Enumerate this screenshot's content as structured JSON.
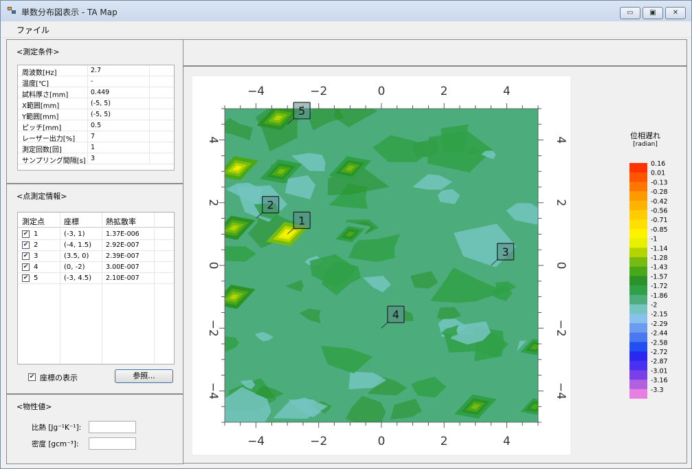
{
  "window": {
    "title": "単数分布図表示 - TA Map",
    "minimize_glyph": "▭",
    "maximize_glyph": "▣",
    "close_glyph": "✕"
  },
  "menu": {
    "file": "ファイル"
  },
  "measurement_conditions": {
    "title": "<測定条件>",
    "rows": [
      {
        "label": "周波数[Hz]",
        "value": "2.7"
      },
      {
        "label": "温度[℃]",
        "value": "-"
      },
      {
        "label": "試料厚さ[mm]",
        "value": "0.449"
      },
      {
        "label": "X範囲[mm]",
        "value": "(-5, 5)"
      },
      {
        "label": "Y範囲[mm]",
        "value": "(-5, 5)"
      },
      {
        "label": "ピッチ[mm]",
        "value": "0.5"
      },
      {
        "label": "レーザー出力[%]",
        "value": "7"
      },
      {
        "label": "測定回数[回]",
        "value": "1"
      },
      {
        "label": "サンプリング間隔[s]",
        "value": "3"
      }
    ]
  },
  "point_info": {
    "title": "<点測定情報>",
    "headers": {
      "point": "測定点",
      "coord": "座標",
      "diffusivity": "熱拡散率"
    },
    "rows": [
      {
        "checked": true,
        "point": "1",
        "coord": "(-3, 1)",
        "diffusivity": "1.37E-006"
      },
      {
        "checked": true,
        "point": "2",
        "coord": "(-4, 1.5)",
        "diffusivity": "2.92E-007"
      },
      {
        "checked": true,
        "point": "3",
        "coord": "(3.5, 0)",
        "diffusivity": "2.39E-007"
      },
      {
        "checked": true,
        "point": "4",
        "coord": "(0, -2)",
        "diffusivity": "3.00E-007"
      },
      {
        "checked": true,
        "point": "5",
        "coord": "(-3, 4.5)",
        "diffusivity": "2.10E-007"
      }
    ],
    "show_coords_label": "座標の表示",
    "show_coords_checked": true,
    "browse_button": "参照..."
  },
  "properties": {
    "title": "<物性値>",
    "specific_heat_label": "比熱 [Jg⁻¹K⁻¹]:",
    "specific_heat_value": "",
    "density_label": "密度 [gcm⁻³]:",
    "density_value": ""
  },
  "chart_data": {
    "type": "heatmap",
    "xlim": [
      -5,
      5
    ],
    "ylim": [
      -5,
      5
    ],
    "xticks": [
      -4,
      -2,
      0,
      2,
      4
    ],
    "yticks": [
      -4,
      -2,
      0,
      2,
      4
    ],
    "tick_labels": [
      "−4",
      "−2",
      "0",
      "2",
      "4"
    ],
    "colorbar": {
      "title": "位相遅れ",
      "unit": "[radian]",
      "levels": [
        "0.16",
        "0.01",
        "-0.13",
        "-0.28",
        "-0.42",
        "-0.56",
        "-0.71",
        "-0.85",
        "-1",
        "-1.14",
        "-1.28",
        "-1.43",
        "-1.57",
        "-1.72",
        "-1.86",
        "-2",
        "-2.15",
        "-2.29",
        "-2.44",
        "-2.58",
        "-2.72",
        "-2.87",
        "-3.01",
        "-3.16",
        "-3.3"
      ],
      "colors": [
        "#ff3300",
        "#ff5500",
        "#ff7700",
        "#ff9900",
        "#ffb300",
        "#ffcc00",
        "#ffe000",
        "#fff200",
        "#e8f000",
        "#b4d400",
        "#78bb10",
        "#48a818",
        "#2a9228",
        "#30a048",
        "#4cac7c",
        "#74c4c0",
        "#88c2ec",
        "#6c9cf0",
        "#4a78f0",
        "#2250f0",
        "#2828f0",
        "#4a30f0",
        "#7a40e8",
        "#b060e0",
        "#e880e0"
      ]
    },
    "points": [
      {
        "label": "1",
        "x": -3,
        "y": 1
      },
      {
        "label": "2",
        "x": -4,
        "y": 1.5
      },
      {
        "label": "3",
        "x": 3.5,
        "y": 0
      },
      {
        "label": "4",
        "x": 0,
        "y": -2
      },
      {
        "label": "5",
        "x": -3,
        "y": 4.5
      }
    ],
    "hotspots": [
      {
        "x": -4.6,
        "y": 3.1,
        "level": "-1"
      },
      {
        "x": -3,
        "y": 1,
        "level": "-0.85"
      },
      {
        "x": -3.3,
        "y": 4.7,
        "level": "-1.14"
      },
      {
        "x": -4.7,
        "y": 1.2,
        "level": "-1.14"
      },
      {
        "x": -4.7,
        "y": -1,
        "level": "-1.14"
      },
      {
        "x": -3.2,
        "y": 3,
        "level": "-1.28"
      },
      {
        "x": -1,
        "y": 3.1,
        "level": "-1.28"
      },
      {
        "x": -1,
        "y": 1,
        "level": "-1.43"
      },
      {
        "x": 3,
        "y": -4.5,
        "level": "-1.28"
      },
      {
        "x": 4.9,
        "y": -4.5,
        "level": "-1.43"
      },
      {
        "x": 4.9,
        "y": -2.6,
        "level": "-1.43"
      }
    ]
  }
}
